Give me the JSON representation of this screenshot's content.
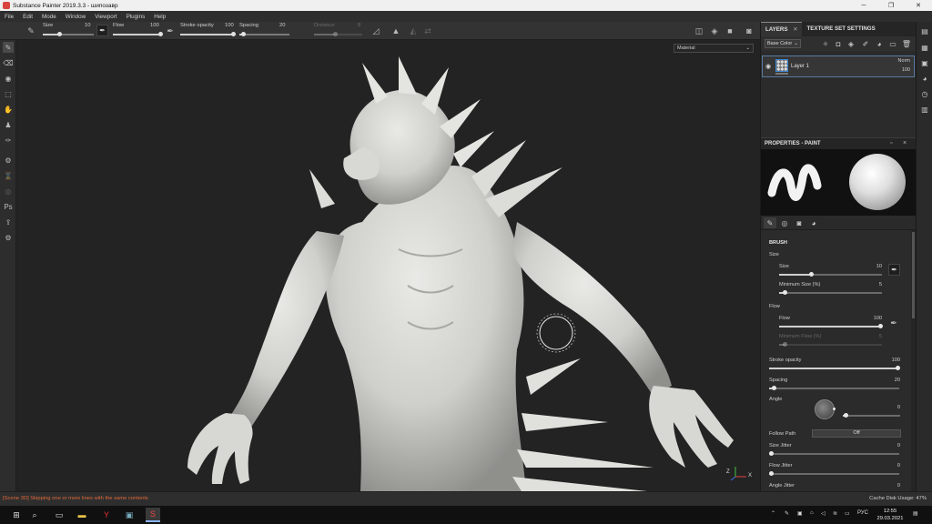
{
  "window": {
    "title": "Substance Painter 2019.3.3 - шипозавр",
    "minimize_glyph": "─",
    "maximize_glyph": "❐",
    "close_glyph": "✕"
  },
  "menu": [
    "File",
    "Edit",
    "Mode",
    "Window",
    "Viewport",
    "Plugins",
    "Help"
  ],
  "toolbar": {
    "size_label": "Size",
    "size_value": "10",
    "flow_label": "Flow",
    "flow_value": "100",
    "stroke_opacity_label": "Stroke opacity",
    "stroke_opacity_value": "100",
    "spacing_label": "Spacing",
    "spacing_value": "20",
    "distance_label": "Distance",
    "distance_value": "8"
  },
  "viewport": {
    "material_mode": "Material",
    "axis_z": "Z",
    "axis_x": "X"
  },
  "layers_panel": {
    "tab_layers": "LAYERS",
    "tab_close": "✕",
    "tab_texture_set": "TEXTURE SET SETTINGS",
    "channel": "Base Color",
    "layers": [
      {
        "name": "Layer 1",
        "blend": "Norm",
        "opacity": "100"
      }
    ]
  },
  "properties": {
    "title": "PROPERTIES - PAINT",
    "section_brush": "BRUSH",
    "group_size": "Size",
    "size_label": "Size",
    "size_value": "10",
    "min_size_label": "Minimum Size (%)",
    "min_size_value": "5",
    "group_flow": "Flow",
    "flow_label": "Flow",
    "flow_value": "100",
    "min_flow_label": "Minimum Flow (%)",
    "min_flow_value": "5",
    "stroke_opacity_label": "Stroke opacity",
    "stroke_opacity_value": "100",
    "spacing_label": "Spacing",
    "spacing_value": "20",
    "angle_label": "Angle",
    "angle_value": "0",
    "follow_path_label": "Follow Path",
    "follow_path_value": "Off",
    "size_jitter_label": "Size Jitter",
    "size_jitter_value": "0",
    "flow_jitter_label": "Flow Jitter",
    "flow_jitter_value": "0",
    "angle_jitter_label": "Angle Jitter",
    "angle_jitter_value": "0"
  },
  "statusbar": {
    "message": "[Scene 3D] Skipping one or more lines with the same contents",
    "cache": "Cache Disk Usage:   47%"
  },
  "taskbar": {
    "language": "РУС",
    "time": "12:55",
    "date": "29.03.2021"
  },
  "colors": {
    "accent": "#5a7aa0",
    "status_warning": "#e26a3a",
    "app_red": "#d9443f"
  }
}
